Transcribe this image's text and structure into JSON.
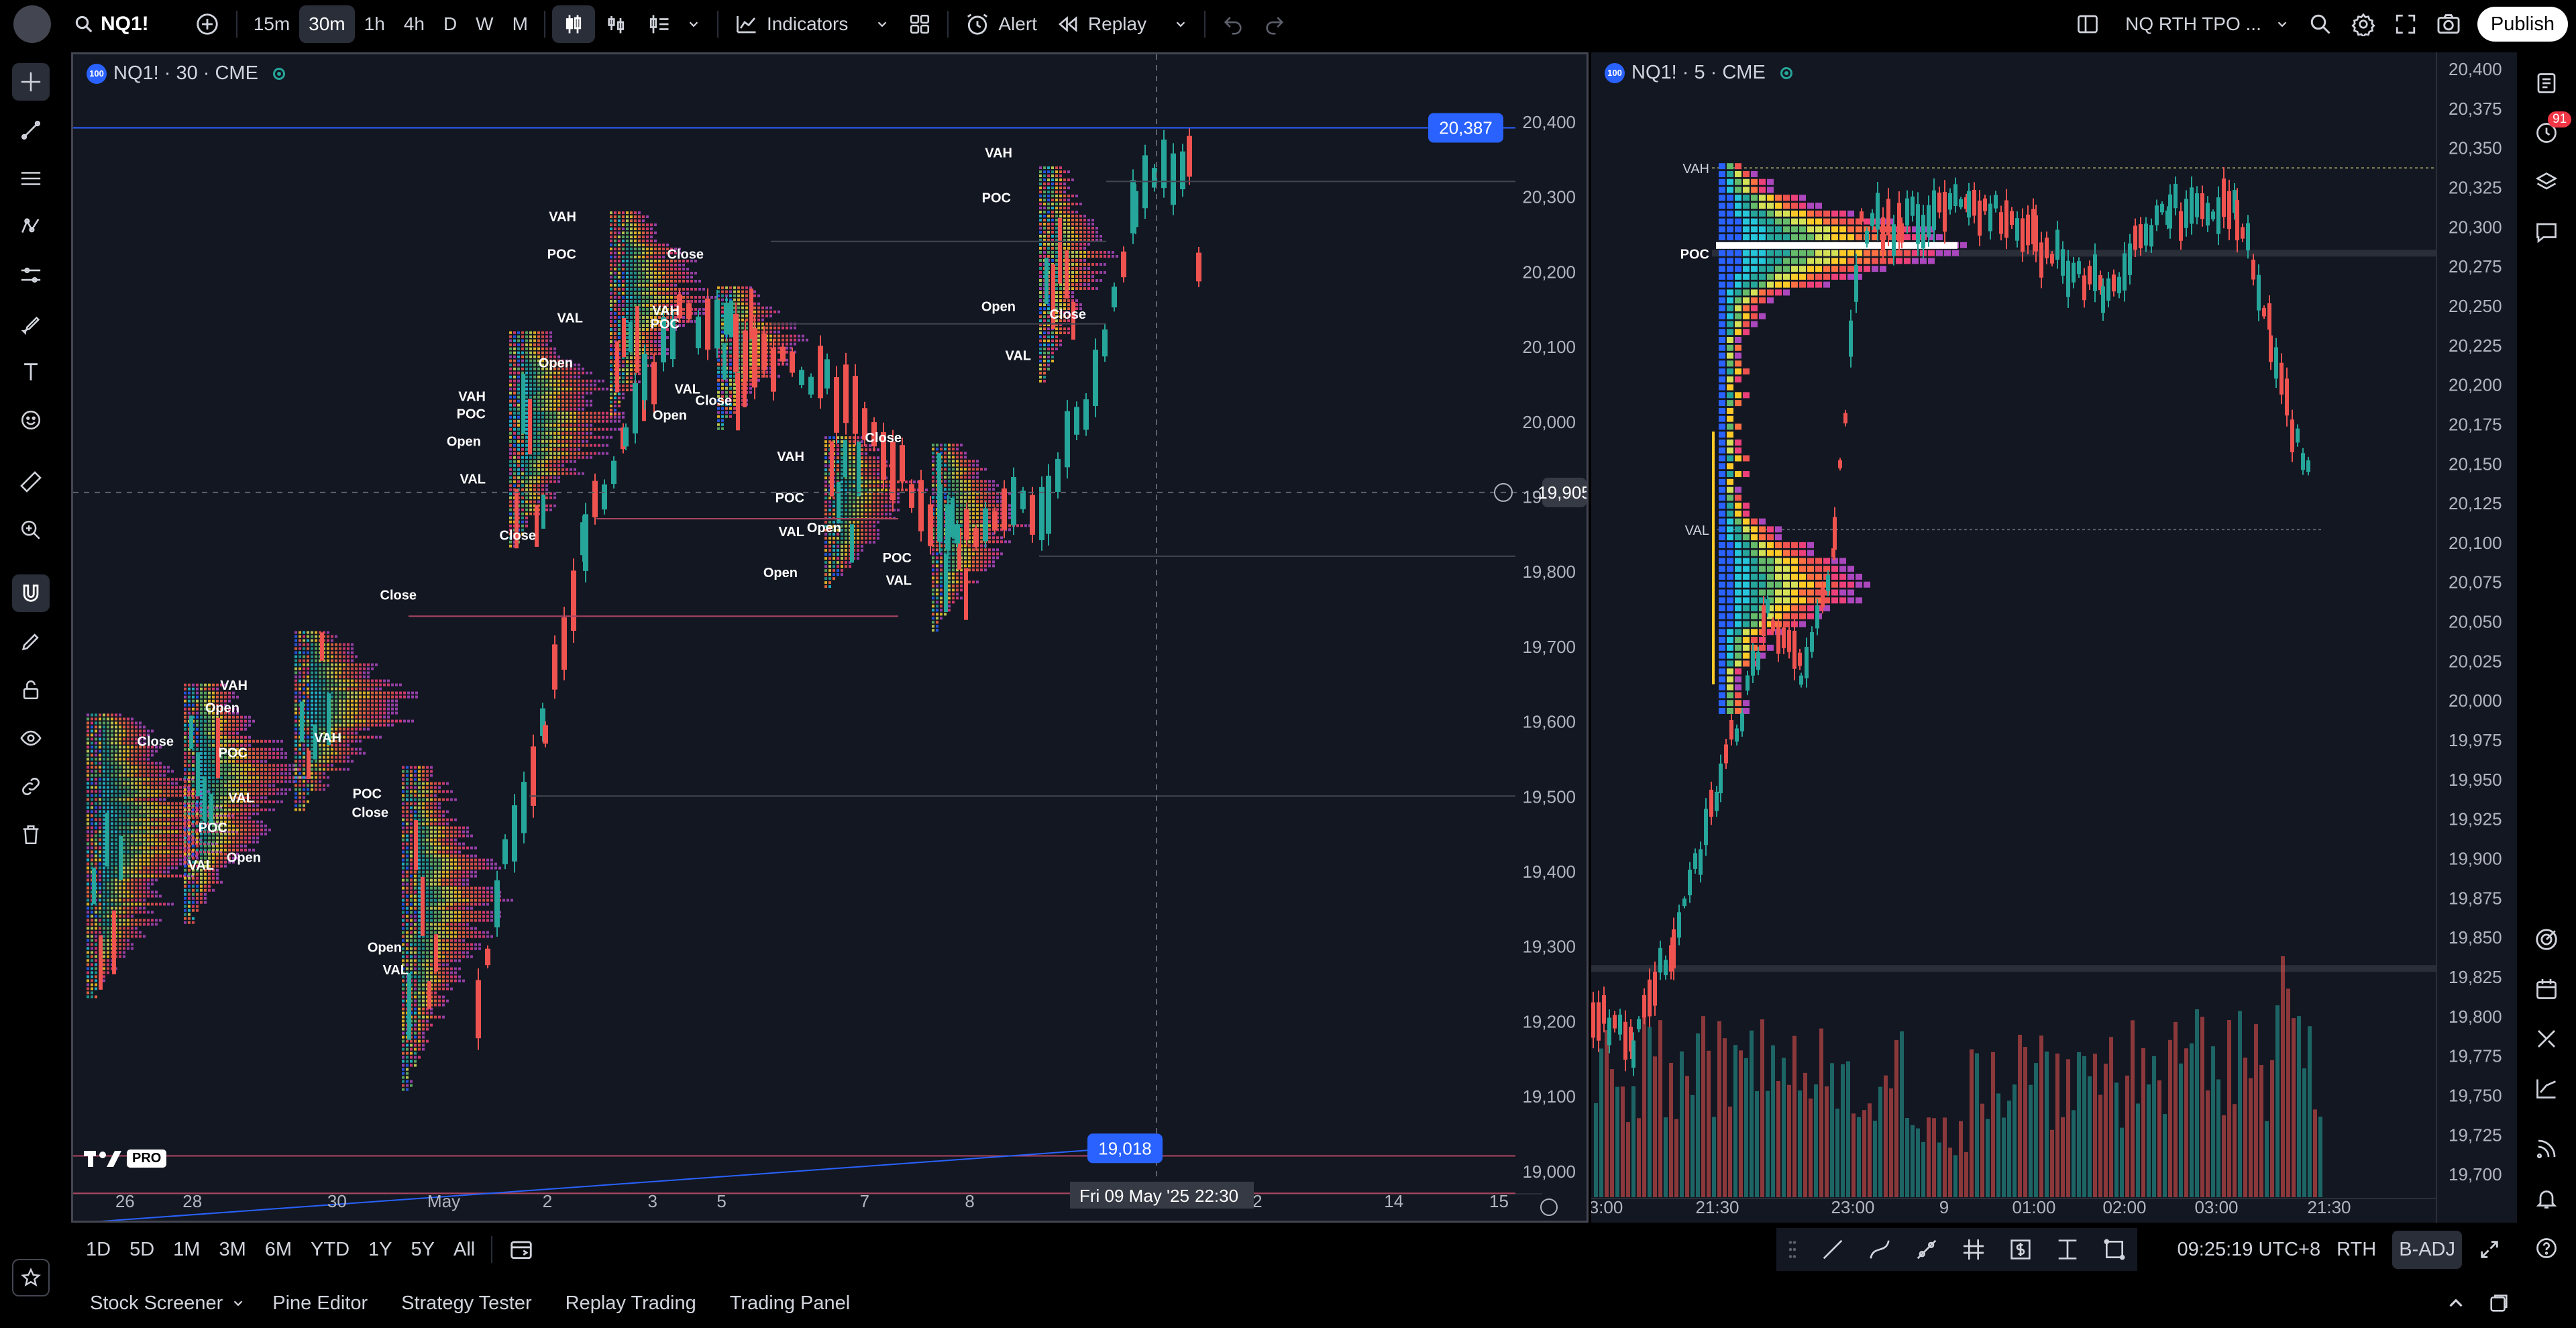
{
  "topbar": {
    "symbol": "NQ1!",
    "intervals": [
      "15m",
      "30m",
      "1h",
      "4h",
      "D",
      "W",
      "M"
    ],
    "active_interval": "30m",
    "indicators_label": "Indicators",
    "alert_label": "Alert",
    "replay_label": "Replay",
    "layout_name": "NQ RTH TPO ...",
    "publish_label": "Publish"
  },
  "pane1": {
    "legend": "NQ1! · 30 · CME",
    "logo": "100",
    "price_axis": [
      "20,400",
      "20,300",
      "20,200",
      "20,100",
      "20,000",
      "19,900",
      "19,800",
      "19,700",
      "19,600",
      "19,500",
      "19,400",
      "19,300",
      "19,200",
      "19,100",
      "19,000"
    ],
    "time_axis": [
      "26",
      "28",
      "30",
      "May",
      "2",
      "3",
      "5",
      "7",
      "8",
      "2",
      "14",
      "15"
    ],
    "crosshair_date": "Fri 09 May '25",
    "crosshair_time": "22:30",
    "crosshair_price": "19,905",
    "top_label": "20,387",
    "bottom_label": "19,018",
    "tv_pro": "PRO",
    "profile_labels": [
      "VAH",
      "POC",
      "VAL",
      "Open",
      "Close"
    ]
  },
  "pane2": {
    "legend": "NQ1! · 5 · CME",
    "logo": "100",
    "price_axis": [
      "20,400",
      "20,375",
      "20,350",
      "20,325",
      "20,300",
      "20,275",
      "20,250",
      "20,225",
      "20,200",
      "20,175",
      "20,150",
      "20,125",
      "20,100",
      "20,075",
      "20,050",
      "20,025",
      "20,000",
      "19,975",
      "19,950",
      "19,925",
      "19,900",
      "19,875",
      "19,850",
      "19,825",
      "19,800",
      "19,775",
      "19,750",
      "19,725",
      "19,700"
    ],
    "time_axis": [
      "3:00",
      "21:30",
      "23:00",
      "9",
      "01:00",
      "02:00",
      "03:00",
      "21:30"
    ],
    "labels": {
      "vah": "VAH",
      "poc": "POC",
      "val": "VAL"
    }
  },
  "bottombar": {
    "ranges": [
      "1D",
      "5D",
      "1M",
      "3M",
      "6M",
      "YTD",
      "1Y",
      "5Y",
      "All"
    ],
    "clock": "09:25:19 UTC+8",
    "session": "RTH",
    "adj": "B-ADJ"
  },
  "bottomtabs": {
    "items": [
      "Stock Screener",
      "Pine Editor",
      "Strategy Tester",
      "Replay Trading",
      "Trading Panel"
    ]
  },
  "rightbar": {
    "notification_count": "91"
  },
  "colors": {
    "bg": "#131722",
    "up": "#26a69a",
    "down": "#ef5350",
    "accent": "#2962ff"
  }
}
